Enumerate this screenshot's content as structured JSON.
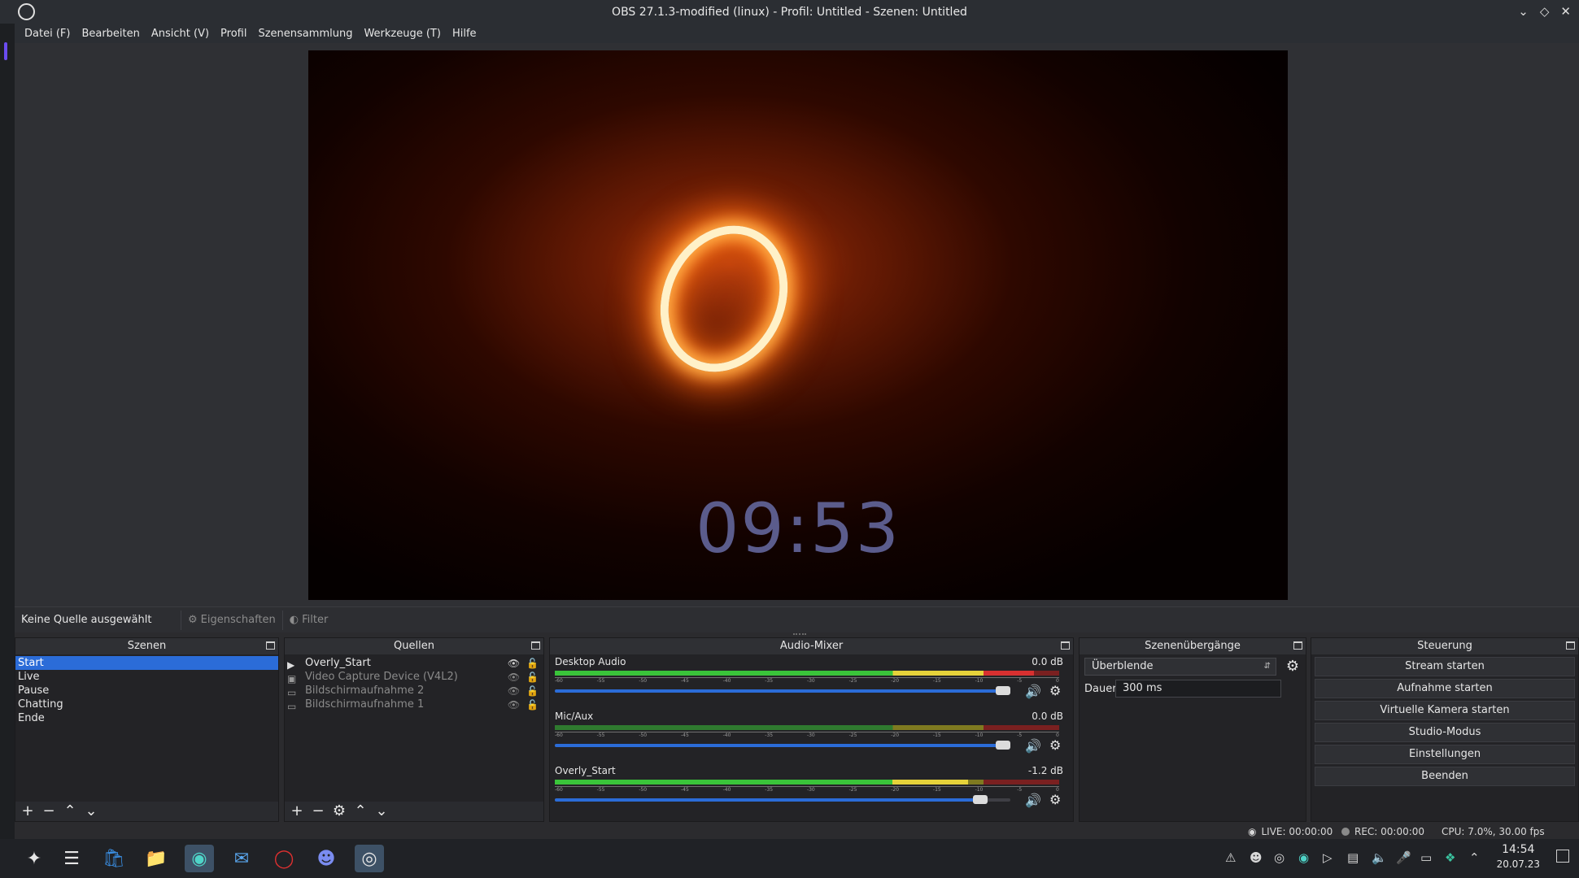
{
  "window": {
    "title": "OBS 27.1.3-modified (linux) - Profil: Untitled - Szenen: Untitled",
    "controls": [
      "⌄",
      "◇",
      "✕"
    ]
  },
  "menu": [
    "Datei (F)",
    "Bearbeiten",
    "Ansicht (V)",
    "Profil",
    "Szenensammlung",
    "Werkzeuge (T)",
    "Hilfe"
  ],
  "preview": {
    "clock_text": "09:53"
  },
  "source_bar": {
    "no_source": "Keine Quelle ausgewählt",
    "properties": "Eigenschaften",
    "filters": "Filter"
  },
  "scenes": {
    "title": "Szenen",
    "items": [
      "Start",
      "Live",
      "Pause",
      "Chatting",
      "Ende"
    ],
    "selected": "Start"
  },
  "sources": {
    "title": "Quellen",
    "items": [
      {
        "name": "Overly_Start",
        "icon": "play-icon",
        "visible": true
      },
      {
        "name": "Video Capture Device (V4L2)",
        "icon": "camera-icon",
        "visible": false
      },
      {
        "name": "Bildschirmaufnahme 2",
        "icon": "monitor-icon",
        "visible": false
      },
      {
        "name": "Bildschirmaufnahme 1",
        "icon": "monitor-icon",
        "visible": false
      }
    ]
  },
  "audio_mixer": {
    "title": "Audio-Mixer",
    "tick_labels": [
      "-60",
      "-55",
      "-50",
      "-45",
      "-40",
      "-35",
      "-30",
      "-25",
      "-20",
      "-15",
      "-10",
      "-5",
      "0"
    ],
    "channels": [
      {
        "name": "Desktop Audio",
        "db": "0.0 dB",
        "volume_fraction": 1.0,
        "level_fraction": 0.95
      },
      {
        "name": "Mic/Aux",
        "db": "0.0 dB",
        "volume_fraction": 1.0,
        "level_fraction": 0.0
      },
      {
        "name": "Overly_Start",
        "db": "-1.2 dB",
        "volume_fraction": 0.95,
        "level_fraction": 0.82
      }
    ]
  },
  "transitions": {
    "title": "Szenenübergänge",
    "selected": "Überblende",
    "duration_label": "Dauer",
    "duration_value": "300 ms"
  },
  "controls": {
    "title": "Steuerung",
    "buttons": [
      "Stream starten",
      "Aufnahme starten",
      "Virtuelle Kamera starten",
      "Studio-Modus",
      "Einstellungen",
      "Beenden"
    ]
  },
  "status": {
    "live": "LIVE: 00:00:00",
    "rec": "REC: 00:00:00",
    "cpu": "CPU: 7.0%, 30.00 fps"
  },
  "taskbar": {
    "time": "14:54",
    "date": "20.07.23"
  },
  "colors": {
    "accent": "#2b6cd8",
    "meter_green": "#3ac43a",
    "meter_yellow": "#e6d23a",
    "meter_red": "#d83030"
  }
}
